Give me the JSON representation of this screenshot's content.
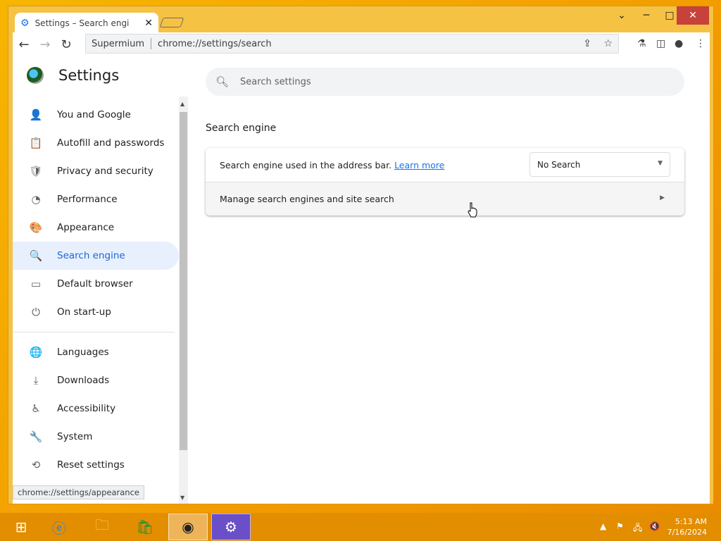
{
  "browser": {
    "tab_title": "Settings – Search engi",
    "tab_close": "✕",
    "omnibox_site": "Supermium",
    "omnibox_url": "chrome://settings/search",
    "window_controls": {
      "chevron": "⌄",
      "minimize": "─",
      "maximize": "□",
      "close": "✕"
    }
  },
  "sidebar": {
    "title": "Settings",
    "items": [
      {
        "label": "You and Google",
        "icon": "person-icon",
        "glyph": "👤"
      },
      {
        "label": "Autofill and passwords",
        "icon": "clipboard-icon",
        "glyph": "📋"
      },
      {
        "label": "Privacy and security",
        "icon": "shield-icon",
        "glyph": "🛡"
      },
      {
        "label": "Performance",
        "icon": "gauge-icon",
        "glyph": "◔"
      },
      {
        "label": "Appearance",
        "icon": "palette-icon",
        "glyph": "🎨"
      },
      {
        "label": "Search engine",
        "icon": "search-icon",
        "glyph": "🔍"
      },
      {
        "label": "Default browser",
        "icon": "browser-icon",
        "glyph": "▭"
      },
      {
        "label": "On start-up",
        "icon": "power-icon",
        "glyph": "⏻"
      },
      {
        "label": "Languages",
        "icon": "globe-icon",
        "glyph": "🌐"
      },
      {
        "label": "Downloads",
        "icon": "download-icon",
        "glyph": "⤓"
      },
      {
        "label": "Accessibility",
        "icon": "accessibility-icon",
        "glyph": "♿"
      },
      {
        "label": "System",
        "icon": "wrench-icon",
        "glyph": "🔧"
      },
      {
        "label": "Reset settings",
        "icon": "history-icon",
        "glyph": "⟲"
      }
    ],
    "active_index": 5
  },
  "status_bar": {
    "url": "chrome://settings/appearance"
  },
  "main": {
    "search_placeholder": "Search settings",
    "section_title": "Search engine",
    "row1_text": "Search engine used in the address bar.",
    "row1_link": "Learn more",
    "dropdown_value": "No Search",
    "row2_text": "Manage search engines and site search"
  },
  "taskbar": {
    "time": "5:13 AM",
    "date": "7/16/2024"
  }
}
